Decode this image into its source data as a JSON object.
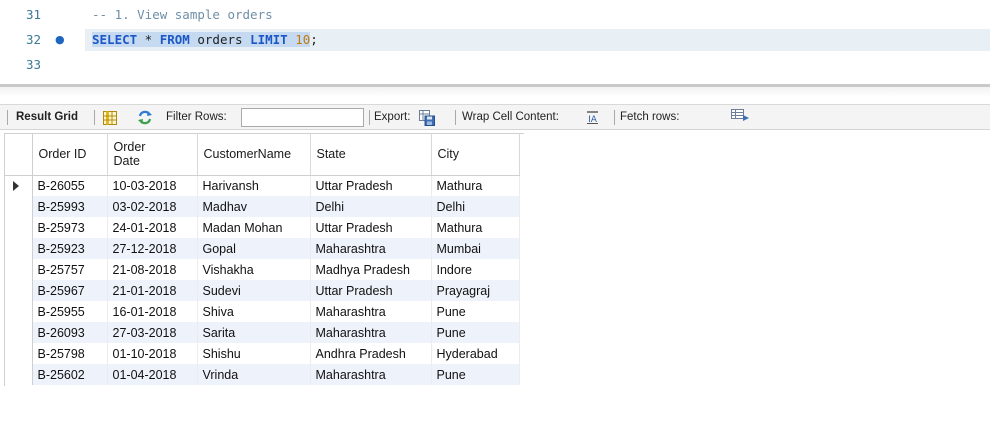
{
  "editor": {
    "lines": [
      {
        "number": "31",
        "comment": "-- 1. View sample orders"
      },
      {
        "number": "32",
        "kw_select": "SELECT",
        "star": " * ",
        "kw_from": "FROM",
        "table": " orders ",
        "kw_limit": "LIMIT",
        "limit_value": " 10",
        "semicolon": ";"
      },
      {
        "number": "33"
      }
    ],
    "exec_marker": "●"
  },
  "toolbar": {
    "result_grid": "Result Grid",
    "filter_rows": "Filter Rows:",
    "filter_value": "",
    "export": "Export:",
    "wrap_cell": "Wrap Cell Content:",
    "fetch_rows": "Fetch rows:"
  },
  "grid": {
    "columns": [
      "Order ID",
      "Order Date",
      "CustomerName",
      "State",
      "City"
    ],
    "rows": [
      [
        "B-26055",
        "10-03-2018",
        "Harivansh",
        "Uttar Pradesh",
        "Mathura"
      ],
      [
        "B-25993",
        "03-02-2018",
        "Madhav",
        "Delhi",
        "Delhi"
      ],
      [
        "B-25973",
        "24-01-2018",
        "Madan Mohan",
        "Uttar Pradesh",
        "Mathura"
      ],
      [
        "B-25923",
        "27-12-2018",
        "Gopal",
        "Maharashtra",
        "Mumbai"
      ],
      [
        "B-25757",
        "21-08-2018",
        "Vishakha",
        "Madhya Pradesh",
        "Indore"
      ],
      [
        "B-25967",
        "21-01-2018",
        "Sudevi",
        "Uttar Pradesh",
        "Prayagraj"
      ],
      [
        "B-25955",
        "16-01-2018",
        "Shiva",
        "Maharashtra",
        "Pune"
      ],
      [
        "B-26093",
        "27-03-2018",
        "Sarita",
        "Maharashtra",
        "Pune"
      ],
      [
        "B-25798",
        "01-10-2018",
        "Shishu",
        "Andhra Pradesh",
        "Hyderabad"
      ],
      [
        "B-25602",
        "01-04-2018",
        "Vrinda",
        "Maharashtra",
        "Pune"
      ]
    ]
  },
  "colors": {
    "keyword": "#1b57c6",
    "comment": "#6f8fa6",
    "number": "#c17a10",
    "current_line": "#e8f0f6",
    "selection": "#c5daf0",
    "alt_row": "#eef3fb"
  }
}
